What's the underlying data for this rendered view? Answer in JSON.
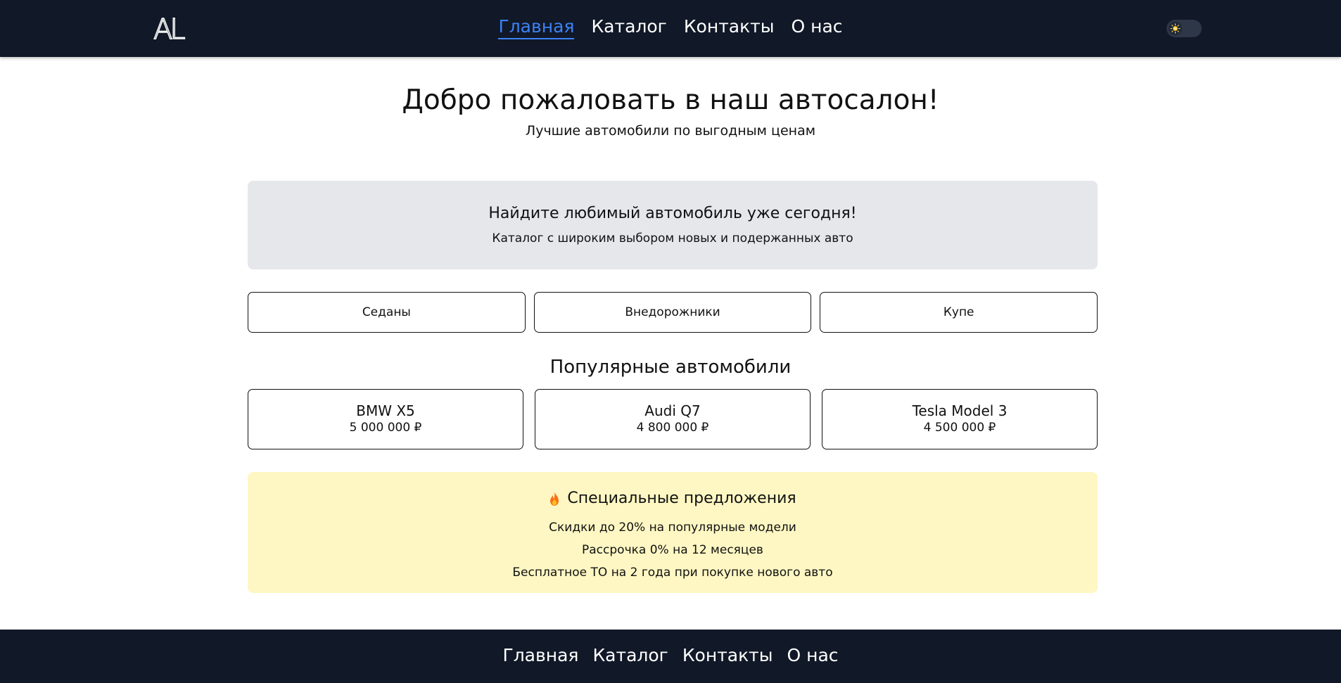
{
  "header": {
    "logo": "AL",
    "nav": [
      {
        "label": "Главная",
        "active": true
      },
      {
        "label": "Каталог",
        "active": false
      },
      {
        "label": "Контакты",
        "active": false
      },
      {
        "label": "О нас",
        "active": false
      }
    ],
    "theme_toggle_icon": "sun-icon"
  },
  "hero": {
    "title": "Добро пожаловать в наш автосалон!",
    "subtitle": "Лучшие автомобили по выгодным ценам"
  },
  "banner": {
    "title": "Найдите любимый автомобиль уже сегодня!",
    "subtitle": "Каталог с широким выбором новых и подержанных авто"
  },
  "categories": [
    "Седаны",
    "Внедорожники",
    "Купе"
  ],
  "popular": {
    "title": "Популярные автомобили",
    "cars": [
      {
        "name": "BMW X5",
        "price": "5 000 000 ₽"
      },
      {
        "name": "Audi Q7",
        "price": "4 800 000 ₽"
      },
      {
        "name": "Tesla Model 3",
        "price": "4 500 000 ₽"
      }
    ]
  },
  "offers": {
    "icon": "fire-icon",
    "title": "Специальные предложения",
    "items": [
      "Скидки до 20% на популярные модели",
      "Рассрочка 0% на 12 месяцев",
      "Бесплатное ТО на 2 года при покупке нового авто"
    ]
  },
  "footer": {
    "nav": [
      "Главная",
      "Каталог",
      "Контакты",
      "О нас"
    ]
  },
  "colors": {
    "header_bg": "#111827",
    "accent": "#3b82f6",
    "banner_bg": "#e5e7eb",
    "offers_bg": "#fef7c3"
  }
}
